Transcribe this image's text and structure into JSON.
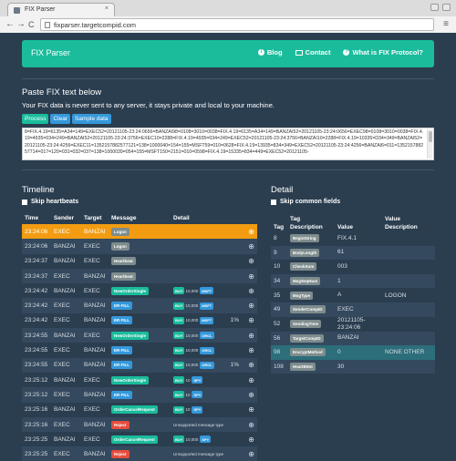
{
  "browser": {
    "tab_title": "FIX Parser",
    "url": "fixparser.targetcompid.com",
    "tab_close": "×",
    "back": "←",
    "forward": "→",
    "reload": "C",
    "menu": "≡"
  },
  "navbar": {
    "brand": "FIX Parser",
    "links": {
      "blog": "Blog",
      "contact": "Contact",
      "about": "What is FIX Protocol?"
    }
  },
  "paste": {
    "title": "Paste FIX text below",
    "note": "Your FIX data is never sent to any server, it stays private and local to your machine.",
    "buttons": {
      "process": "Process",
      "clear": "Clear",
      "sample": "Sample data"
    },
    "text": "8=FIX.4.19=6135=A34=149=EXEC52=20121105-23:24:0656=BANZAI98=0108=3010=0038=FIX.4.19=6135=A34=149=BANZAI52=20121105-23:24:0656=EXEC98=0108=3010=0038=FIX.4.19=4935=034=249=BANZAI52=20121105-23:24:3756=EXEC10=2288=FIX.4.19=4935=034=249=EXEC52=20121105-23:24:3756=BANZAI10=2288=FIX.4.19=10335=D34=349=BANZAI52=20121105-23:24:4256=EXEC11=1352157882577121=138=1000040=154=155=MSFT59=010=0628=FIX.4.19=13935=834=349=EXEC52=20121105-23:24:4256=BANZAI6=011=135215788257714=017=120=031=032=037=138=1000039=054=155=MSFT150=2151=010=0598=FIX.4.19=15335=834=449=EXEC52=20121105-"
  },
  "timeline": {
    "title": "Timeline",
    "skip": "Skip heartbeats",
    "headers": [
      "Time",
      "Sender",
      "Target",
      "Message",
      "Detail"
    ],
    "rows": [
      {
        "time": "23:24:06",
        "sender": "EXEC",
        "target": "BANZAI",
        "message": "Logon",
        "color": "gray",
        "detail_type": "none",
        "side": "",
        "qty": "",
        "sym": "",
        "pct": "",
        "text": "",
        "zoom": "⊕"
      },
      {
        "time": "23:24:06",
        "sender": "BANZAI",
        "target": "EXEC",
        "message": "Logon",
        "color": "gray",
        "detail_type": "none",
        "side": "",
        "qty": "",
        "sym": "",
        "pct": "",
        "text": "",
        "zoom": "⊕"
      },
      {
        "time": "23:24:37",
        "sender": "BANZAI",
        "target": "EXEC",
        "message": "Heartbeat",
        "color": "gray",
        "detail_type": "none",
        "side": "",
        "qty": "",
        "sym": "",
        "pct": "",
        "text": "",
        "zoom": "⊕"
      },
      {
        "time": "23:24:37",
        "sender": "EXEC",
        "target": "BANZAI",
        "message": "Heartbeat",
        "color": "gray",
        "detail_type": "none",
        "side": "",
        "qty": "",
        "sym": "",
        "pct": "",
        "text": "",
        "zoom": "⊕"
      },
      {
        "time": "23:24:42",
        "sender": "BANZAI",
        "target": "EXEC",
        "message": "NewOrderSingle",
        "color": "green",
        "detail_type": "order",
        "side": "BUY",
        "qty": "10,000",
        "sym": "MSFT",
        "pct": "",
        "text": "",
        "zoom": "⊕"
      },
      {
        "time": "23:24:42",
        "sender": "EXEC",
        "target": "BANZAI",
        "message": "ER FILL",
        "color": "blue",
        "detail_type": "order",
        "side": "BUY",
        "qty": "10,000",
        "sym": "MSFT",
        "pct": "",
        "text": "",
        "zoom": "⊕"
      },
      {
        "time": "23:24:42",
        "sender": "EXEC",
        "target": "BANZAI",
        "message": "ER FILL",
        "color": "blue",
        "detail_type": "order",
        "side": "BUY",
        "qty": "10,000",
        "sym": "MSFT",
        "pct": "1%",
        "text": "",
        "zoom": "⊕"
      },
      {
        "time": "23:24:55",
        "sender": "BANZAI",
        "target": "EXEC",
        "message": "NewOrderSingle",
        "color": "green",
        "detail_type": "order",
        "side": "BUY",
        "qty": "10,000",
        "sym": "ORCL",
        "pct": "",
        "text": "",
        "zoom": "⊕"
      },
      {
        "time": "23:24:55",
        "sender": "EXEC",
        "target": "BANZAI",
        "message": "ER FILL",
        "color": "blue",
        "detail_type": "order",
        "side": "BUY",
        "qty": "10,000",
        "sym": "ORCL",
        "pct": "",
        "text": "",
        "zoom": "⊕"
      },
      {
        "time": "23:24:55",
        "sender": "EXEC",
        "target": "BANZAI",
        "message": "ER FILL",
        "color": "blue",
        "detail_type": "order",
        "side": "BUY",
        "qty": "10,000",
        "sym": "ORCL",
        "pct": "1%",
        "text": "",
        "zoom": "⊕"
      },
      {
        "time": "23:25:12",
        "sender": "BANZAI",
        "target": "EXEC",
        "message": "NewOrderSingle",
        "color": "green",
        "detail_type": "order",
        "side": "BUY",
        "qty": "10",
        "sym": "SPY",
        "pct": "",
        "text": "",
        "zoom": "⊕"
      },
      {
        "time": "23:25:12",
        "sender": "EXEC",
        "target": "BANZAI",
        "message": "ER FILL",
        "color": "blue",
        "detail_type": "order",
        "side": "BUY",
        "qty": "10",
        "sym": "SPY",
        "pct": "",
        "text": "",
        "zoom": "⊕"
      },
      {
        "time": "23:25:16",
        "sender": "BANZAI",
        "target": "EXEC",
        "message": "OrderCancelRequest",
        "color": "green",
        "detail_type": "order",
        "side": "BUY",
        "qty": "10",
        "sym": "SPY",
        "pct": "",
        "text": "",
        "zoom": "⊕"
      },
      {
        "time": "23:25:16",
        "sender": "EXEC",
        "target": "BANZAI",
        "message": "Reject",
        "color": "red",
        "detail_type": "text",
        "side": "",
        "qty": "",
        "sym": "",
        "pct": "",
        "text": "Unsupported message type",
        "zoom": "⊕"
      },
      {
        "time": "23:25:25",
        "sender": "BANZAI",
        "target": "EXEC",
        "message": "OrderCancelRequest",
        "color": "green",
        "detail_type": "order",
        "side": "BUY",
        "qty": "10,000",
        "sym": "SPY",
        "pct": "",
        "text": "",
        "zoom": "⊕"
      },
      {
        "time": "23:25:25",
        "sender": "EXEC",
        "target": "BANZAI",
        "message": "Reject",
        "color": "red",
        "detail_type": "text",
        "side": "",
        "qty": "",
        "sym": "",
        "pct": "",
        "text": "Unsupported message type",
        "zoom": "⊕"
      }
    ]
  },
  "detail": {
    "title": "Detail",
    "skip": "Skip common fields",
    "headers": {
      "tag": "Tag",
      "tagdesc": "Tag Description",
      "value": "Value",
      "valdesc": "Value Description"
    },
    "rows": [
      {
        "tag": "8",
        "desc": "BeginString",
        "value": "FIX.4.1",
        "vdesc": ""
      },
      {
        "tag": "9",
        "desc": "BodyLength",
        "value": "61",
        "vdesc": ""
      },
      {
        "tag": "10",
        "desc": "CheckSum",
        "value": "003",
        "vdesc": ""
      },
      {
        "tag": "34",
        "desc": "MsgSeqNum",
        "value": "1",
        "vdesc": ""
      },
      {
        "tag": "35",
        "desc": "MsgType",
        "value": "A",
        "vdesc": "LOGON"
      },
      {
        "tag": "49",
        "desc": "SenderCompID",
        "value": "EXEC",
        "vdesc": ""
      },
      {
        "tag": "52",
        "desc": "SendingTime",
        "value": "20121105-23:24:06",
        "vdesc": ""
      },
      {
        "tag": "56",
        "desc": "TargetCompID",
        "value": "BANZAI",
        "vdesc": ""
      },
      {
        "tag": "98",
        "desc": "EncryptMethod",
        "value": "0",
        "vdesc": "NONE OTHER"
      },
      {
        "tag": "108",
        "desc": "HeartBtInt",
        "value": "30",
        "vdesc": ""
      }
    ]
  },
  "colors": {
    "accent": "#1abc9c",
    "background": "#2b3e50",
    "selected_row": "#f39c12",
    "info": "#3498db",
    "danger": "#e74c3c"
  }
}
